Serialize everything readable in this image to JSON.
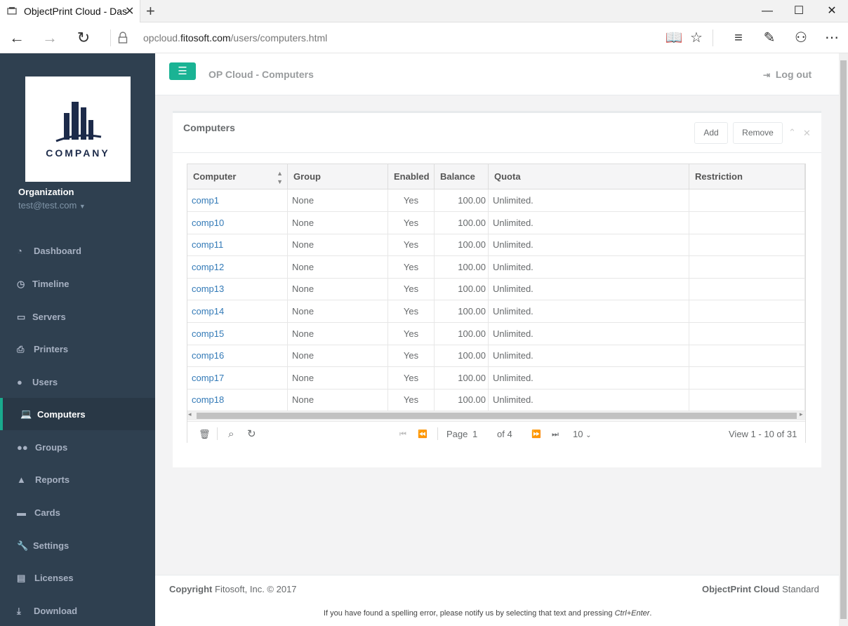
{
  "browser": {
    "tab_title": "ObjectPrint Cloud - Das",
    "url_prefix": "opcloud.",
    "url_domain": "fitosoft.com",
    "url_path": "/users/computers.html"
  },
  "sidebar": {
    "logo_text": "COMPANY",
    "org_name": "Organization",
    "email": "test@test.com",
    "items": [
      {
        "label": "Dashboard",
        "icon": "dashboard-icon"
      },
      {
        "label": "Timeline",
        "icon": "clock-icon"
      },
      {
        "label": "Servers",
        "icon": "server-icon"
      },
      {
        "label": "Printers",
        "icon": "printer-icon"
      },
      {
        "label": "Users",
        "icon": "user-icon"
      },
      {
        "label": "Computers",
        "icon": "laptop-icon",
        "active": true
      },
      {
        "label": "Groups",
        "icon": "users-icon"
      },
      {
        "label": "Reports",
        "icon": "chart-icon"
      },
      {
        "label": "Cards",
        "icon": "card-icon"
      },
      {
        "label": "Settings",
        "icon": "wrench-icon"
      },
      {
        "label": "Licenses",
        "icon": "license-icon"
      },
      {
        "label": "Download",
        "icon": "download-icon"
      }
    ]
  },
  "header": {
    "title": "OP Cloud - Computers",
    "logout": "Log out"
  },
  "panel": {
    "title": "Computers",
    "add": "Add",
    "remove": "Remove"
  },
  "table": {
    "columns": [
      "Computer",
      "Group",
      "Enabled",
      "Balance",
      "Quota",
      "Restriction"
    ],
    "rows": [
      [
        "comp1",
        "None",
        "Yes",
        "100.00",
        "Unlimited.",
        ""
      ],
      [
        "comp10",
        "None",
        "Yes",
        "100.00",
        "Unlimited.",
        ""
      ],
      [
        "comp11",
        "None",
        "Yes",
        "100.00",
        "Unlimited.",
        ""
      ],
      [
        "comp12",
        "None",
        "Yes",
        "100.00",
        "Unlimited.",
        ""
      ],
      [
        "comp13",
        "None",
        "Yes",
        "100.00",
        "Unlimited.",
        ""
      ],
      [
        "comp14",
        "None",
        "Yes",
        "100.00",
        "Unlimited.",
        ""
      ],
      [
        "comp15",
        "None",
        "Yes",
        "100.00",
        "Unlimited.",
        ""
      ],
      [
        "comp16",
        "None",
        "Yes",
        "100.00",
        "Unlimited.",
        ""
      ],
      [
        "comp17",
        "None",
        "Yes",
        "100.00",
        "Unlimited.",
        ""
      ],
      [
        "comp18",
        "None",
        "Yes",
        "100.00",
        "Unlimited.",
        ""
      ]
    ]
  },
  "pager": {
    "page_label": "Page",
    "page_value": "1",
    "of_label": "of 4",
    "rows_per_page": "10",
    "view_text": "View 1 - 10 of 31"
  },
  "footer": {
    "copyright_bold": "Copyright",
    "copyright": "Fitosoft, Inc. © 2017",
    "product_bold": "ObjectPrint Cloud",
    "product_edition": "Standard",
    "spell_text": "If you have found a spelling error, please notify us by selecting that text and pressing",
    "spell_keys": "Ctrl+Enter",
    "spell_end": "."
  },
  "colors": {
    "sidebar": "#2f4050",
    "accent": "#1ab394",
    "link": "#337ab7"
  }
}
